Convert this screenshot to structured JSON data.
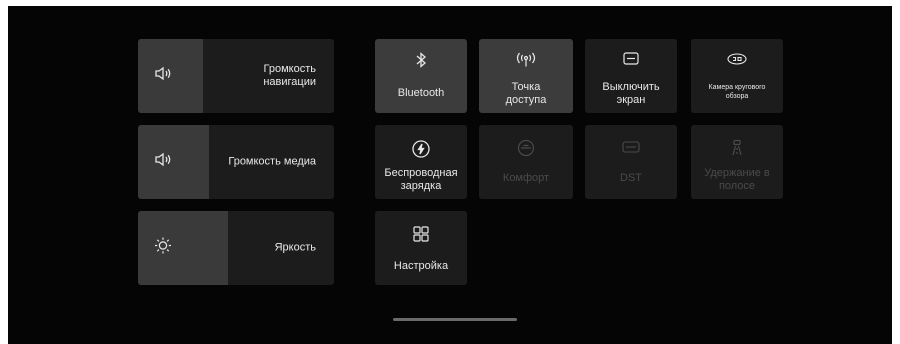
{
  "sliders": [
    {
      "label": "Громкость навигации",
      "icon": "speaker-icon",
      "level": 0.33
    },
    {
      "label": "Громкость медиа",
      "icon": "speaker-icon",
      "level": 0.36
    },
    {
      "label": "Яркость",
      "icon": "sun-icon",
      "level": 0.46
    }
  ],
  "tiles": {
    "bluetooth": {
      "label": "Bluetooth",
      "icon": "bluetooth-icon",
      "state": "active"
    },
    "hotspot": {
      "label": "Точка доступа",
      "icon": "hotspot-icon",
      "state": "active"
    },
    "screen_off": {
      "label": "Выключить экран",
      "icon": "screen-off-icon",
      "state": "normal"
    },
    "camera_360": {
      "label": "Камера кругового обзора",
      "icon": "camera-360-icon",
      "state": "normal"
    },
    "wireless_charging": {
      "label": "Беспроводная зарядка",
      "icon": "wireless-charging-icon",
      "state": "normal"
    },
    "comfort": {
      "label": "Комфорт",
      "icon": "comfort-icon",
      "state": "disabled"
    },
    "dst": {
      "label": "DST",
      "icon": "dst-icon",
      "state": "disabled"
    },
    "lane_keep": {
      "label": "Удержание в полосе",
      "icon": "lane-keep-icon",
      "state": "disabled"
    },
    "settings": {
      "label": "Настройка",
      "icon": "grid-icon",
      "state": "normal"
    }
  },
  "colors": {
    "background": "#050505",
    "tile": "#1c1c1c",
    "tile_active": "#3c3c3c",
    "text": "#e8e8e8",
    "text_disabled": "#4a4a4a"
  }
}
